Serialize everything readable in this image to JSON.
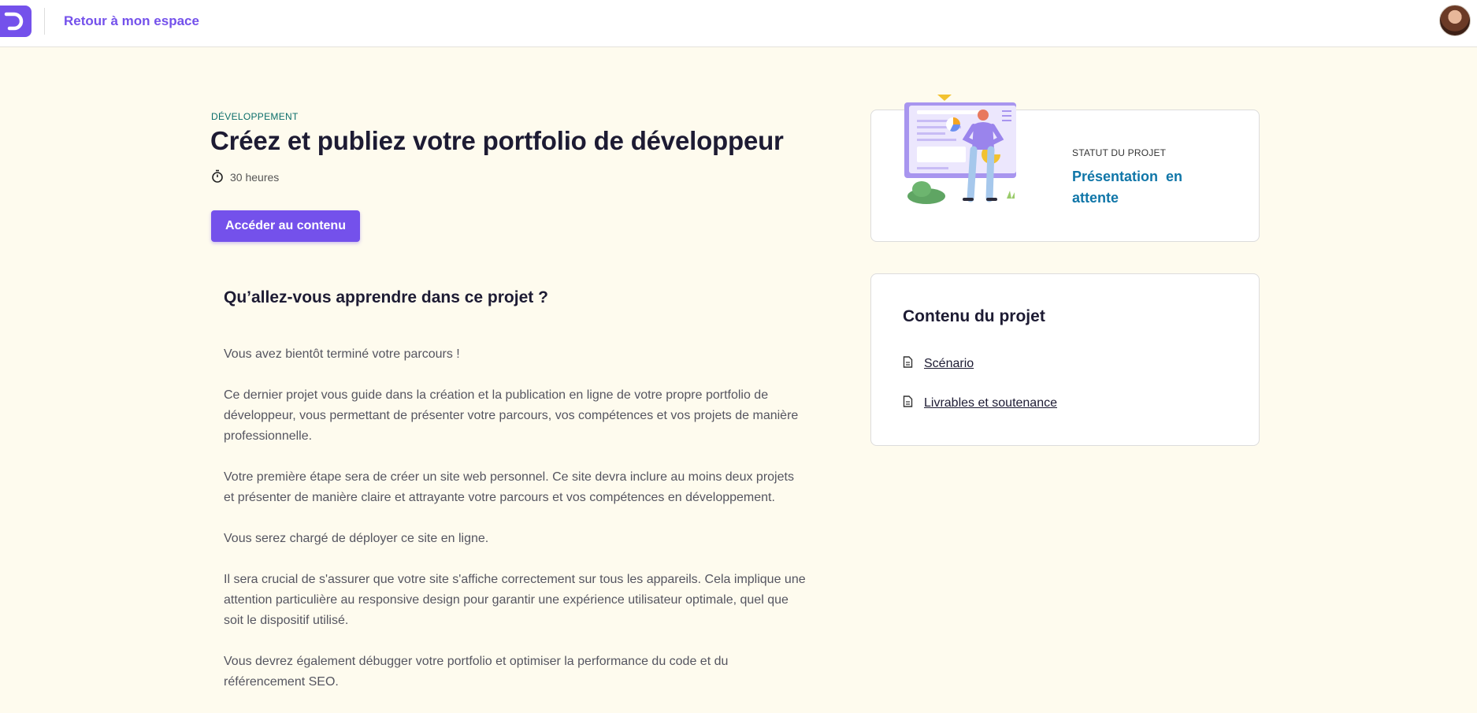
{
  "header": {
    "back_link": "Retour à mon espace",
    "logo_icon": "openclassrooms-logo-icon",
    "avatar_icon": "user-avatar"
  },
  "project": {
    "category": "DÉVELOPPEMENT",
    "title": "Créez et publiez votre portfolio de développeur",
    "duration": "30 heures",
    "cta_label": "Accéder au contenu"
  },
  "learn": {
    "heading": "Qu’allez-vous apprendre dans ce projet ?",
    "paragraphs": [
      "Vous avez bientôt terminé votre parcours !",
      "Ce dernier projet vous guide dans la création et la publication en ligne de votre propre portfolio de développeur, vous permettant de présenter votre parcours, vos compétences et vos projets de manière professionnelle.",
      "Votre première étape sera de créer un site web personnel. Ce site devra inclure au moins deux projets et présenter de manière claire et attrayante votre parcours et vos compétences en développement.",
      "Vous serez chargé de déployer ce site en ligne.",
      "Il sera crucial de s'assurer que votre site s'affiche correctement sur tous les appareils. Cela implique une attention particulière au responsive design pour garantir une expérience utilisateur optimale, quel que soit le dispositif utilisé.",
      "Vous devrez également débugger votre portfolio et optimiser la performance du code et du référencement SEO."
    ]
  },
  "status": {
    "label": "STATUT DU PROJET",
    "value": "Présentation  en\nattente"
  },
  "contents": {
    "title": "Contenu du projet",
    "items": [
      "Scénario",
      "Livrables et soutenance"
    ]
  },
  "colors": {
    "accent": "#7451eb",
    "status": "#1076a8",
    "background": "#fefbee"
  }
}
